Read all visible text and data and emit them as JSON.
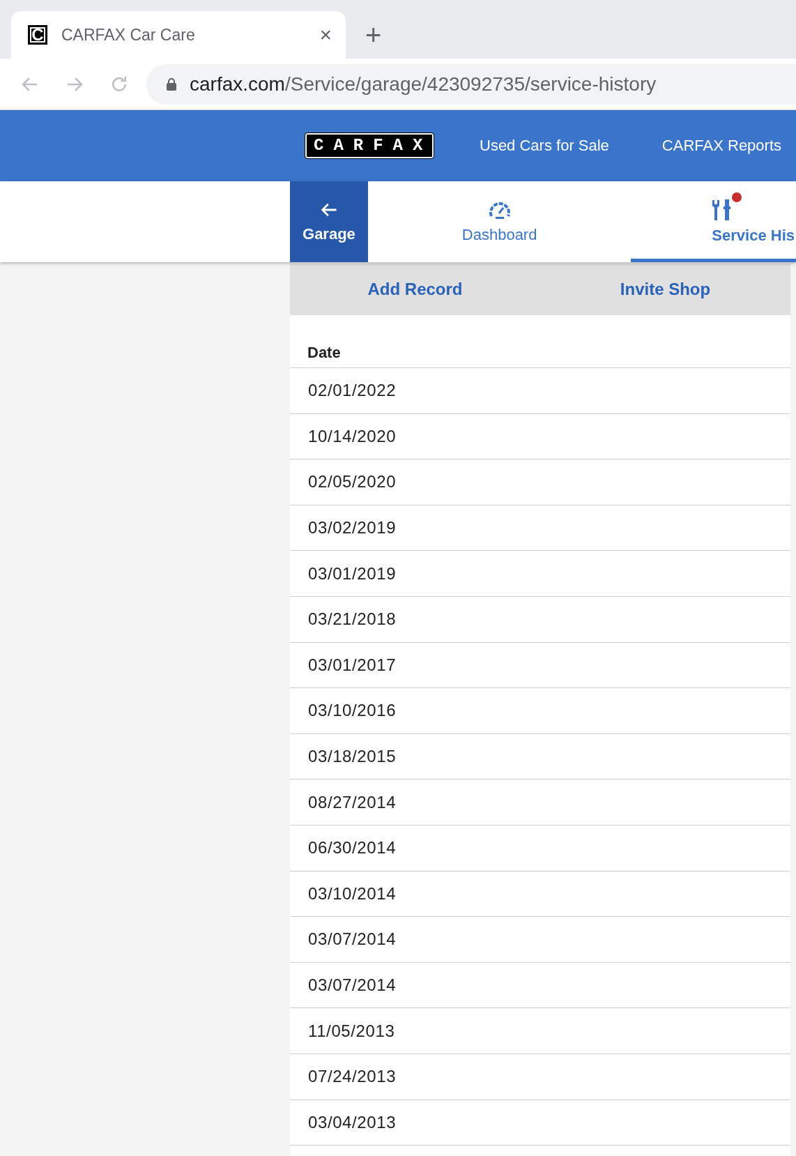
{
  "browser": {
    "tab": {
      "favicon_letter": "C",
      "title": "CARFAX Car Care",
      "close": "×",
      "new_tab": "+"
    },
    "url_host": "carfax.com",
    "url_path": "/Service/garage/423092735/service-history"
  },
  "header": {
    "logo": "CARFAX",
    "links": [
      "Used Cars for Sale",
      "CARFAX Reports"
    ]
  },
  "nav_tabs": [
    {
      "kind": "back",
      "label": "Garage",
      "selected": false,
      "notification": false
    },
    {
      "kind": "dashboard",
      "label": "Dashboard",
      "selected": false,
      "notification": false
    },
    {
      "kind": "service",
      "label": "Service His",
      "selected": true,
      "notification": true
    }
  ],
  "actions": [
    "Add Record",
    "Invite Shop"
  ],
  "table": {
    "columns": [
      "Date"
    ],
    "rows": [
      "02/01/2022",
      "10/14/2020",
      "02/05/2020",
      "03/02/2019",
      "03/01/2019",
      "03/21/2018",
      "03/01/2017",
      "03/10/2016",
      "03/18/2015",
      "08/27/2014",
      "06/30/2014",
      "03/10/2014",
      "03/07/2014",
      "03/07/2014",
      "11/05/2013",
      "07/24/2013",
      "03/04/2013"
    ]
  }
}
